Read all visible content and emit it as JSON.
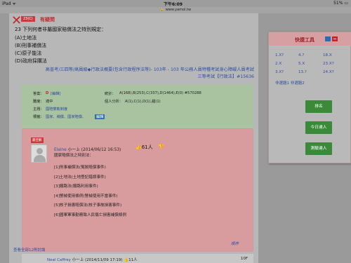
{
  "status": {
    "device": "iPad ᯤ",
    "time": "下午6:09",
    "battery": "51% ▭"
  },
  "browser": {
    "url": "🔒 www.yamol.tw"
  },
  "question": {
    "number": "23(C)",
    "tag": "有疑問",
    "text": "23 下列何者非屬國家賠償法之特別規定：",
    "options": [
      "(A)土地法",
      "(B)刑事補償法",
      "(C)原子能法",
      "(D)政府採購法"
    ],
    "source_line1": "高普考/三四等/高員級◆行政法概要(包含行政程序法等)- 103年 - 103 年公務人員特種考試身心障礙人員考試",
    "source_line2": "三等考試【行政法】#15636"
  },
  "answer_box": {
    "answer_label": "答案：",
    "answer_value": "D",
    "answer_edit": "[編輯]",
    "stats_label": "統計：",
    "stats_value": "A(168),B(253),C(337),D(1464),E(0) #570288",
    "difficulty_label": "難度：",
    "difficulty_value": "適中",
    "personal_label": "個人分析：",
    "personal_value": "A(1),C(1),D(1),錯(1)",
    "topic_label": "主題：",
    "topic_value": "國賠雙軌制度",
    "tags_label": "標籤：",
    "tags_value": "國家、補償、國家賠償、",
    "tags_button": "編輯"
  },
  "comment": {
    "label": "最佳解",
    "author": "Elaine",
    "level": "小一上",
    "date": "(2014/06/12 16:53)",
    "likes": "👍61人",
    "dislike": "👎",
    "lines": [
      "國家賠償法之特別法：",
      "[1]刑事補償法(冤獄賠償事件)",
      "[2]土地法(土地登記錯誤事件)",
      "[3]鐵路法(鐵路利用事件)",
      "[4]警械使用條例(警械使用不當事件)",
      "[5]核子損害賠償法(核子事故損害事件)",
      "[6]國軍軍事勤務致人民傷亡損害補償條例"
    ],
    "more": "順序"
  },
  "all_comments": "查看全部12則討論",
  "next_comment": {
    "author": "Neal Caffrey",
    "level": "小一上",
    "date": "(2014/11/09 17:19)",
    "likes": "👍11人",
    "floor": "10F"
  },
  "tools": {
    "title": "快捷工具",
    "links": [
      [
        "1.X?",
        "4.?",
        "18.X"
      ],
      [
        "2.X",
        "5.X",
        "23.X?"
      ],
      [
        "3.X?",
        "13.?",
        "24.X?"
      ]
    ],
    "sub_links": "非選題1 非選題2",
    "buttons": [
      "排名",
      "今日達人",
      "測驗達人"
    ]
  }
}
